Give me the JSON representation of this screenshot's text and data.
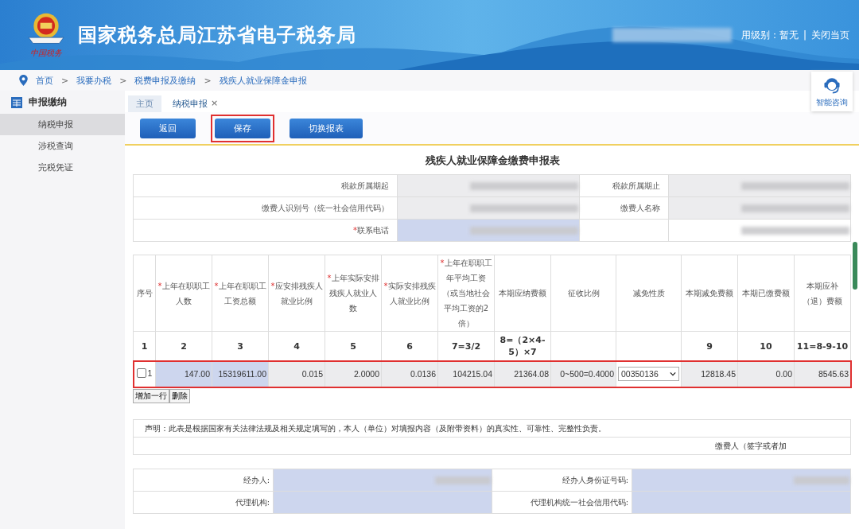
{
  "header": {
    "logo_caption": "中国税务",
    "title": "国家税务总局江苏省电子税务局",
    "user_level": "用级别：暂无",
    "divider": "|",
    "close_link": "关闭当页"
  },
  "breadcrumb": {
    "separator": ">",
    "items": [
      "首页",
      "我要办税",
      "税费申报及缴纳",
      "残疾人就业保障金申报"
    ]
  },
  "help": {
    "label": "智能咨询"
  },
  "sidebar": {
    "title": "申报缴纳",
    "items": [
      {
        "label": "纳税申报",
        "selected": true
      },
      {
        "label": "涉税查询",
        "selected": false
      },
      {
        "label": "完税凭证",
        "selected": false
      }
    ]
  },
  "tabs": [
    {
      "label": "主页",
      "selected": false
    },
    {
      "label": "纳税申报",
      "selected": true,
      "close": "×"
    }
  ],
  "toolbar": [
    {
      "label": "返回",
      "highlighted": false
    },
    {
      "label": "保存",
      "highlighted": true
    },
    {
      "label": "切换报表",
      "highlighted": false
    }
  ],
  "form_title": "残疾人就业保障金缴费申报表",
  "required_mark": "*",
  "info_rows": [
    {
      "fields": [
        {
          "label": "税款所属期起",
          "required": false,
          "kind": "readonly"
        },
        {
          "label": "税款所属期止",
          "required": false,
          "kind": "readonly"
        }
      ]
    },
    {
      "fields": [
        {
          "label": "缴费人识别号（统一社会信用代码）",
          "required": false,
          "kind": "readonly"
        },
        {
          "label": "缴费人名称",
          "required": false,
          "kind": "readonly"
        }
      ]
    },
    {
      "fields": [
        {
          "label": "联系电话",
          "required": true,
          "kind": "input"
        },
        {
          "kind": "plain"
        }
      ]
    }
  ],
  "columns": [
    {
      "label": "序号",
      "required": false,
      "number": "1"
    },
    {
      "label": "上年在职职工人数",
      "required": true,
      "number": "2"
    },
    {
      "label": "上年在职职工工资总额",
      "required": true,
      "number": "3"
    },
    {
      "label": "应安排残疾人就业比例",
      "required": true,
      "number": "4"
    },
    {
      "label": "上年实际安排残疾人就业人数",
      "required": true,
      "number": "5"
    },
    {
      "label": "实际安排残疾人就业比例",
      "required": true,
      "number": "6"
    },
    {
      "label": "上年在职职工年平均工资（或当地社会平均工资的2倍）",
      "required": true,
      "number": "7=3/2"
    },
    {
      "label": "本期应纳费额",
      "required": false,
      "number": "8=（2×4-5）×7"
    },
    {
      "label": "征收比例",
      "required": false
    },
    {
      "label": "减免性质",
      "required": false
    },
    {
      "label": "本期减免费额",
      "required": false,
      "number": "9"
    },
    {
      "label": "本期已缴费额",
      "required": false,
      "number": "10"
    },
    {
      "label": "本期应补（退）费额",
      "required": false,
      "number": "11=8-9-10"
    }
  ],
  "rows": [
    {
      "checked": false,
      "seq": "1",
      "highlighted": true,
      "cells": [
        {
          "value": "147.00",
          "kind": "input"
        },
        {
          "value": "15319611.00",
          "kind": "input"
        },
        {
          "value": "0.015",
          "kind": "readonly"
        },
        {
          "value": "2.0000",
          "kind": "readonly"
        },
        {
          "value": "0.0136",
          "kind": "readonly"
        },
        {
          "value": "104215.04",
          "kind": "readonly"
        },
        {
          "value": "21364.08",
          "kind": "readonly"
        },
        {
          "value": "0~500=0.4000",
          "kind": "readonly"
        },
        {
          "value": "00350136",
          "kind": "select"
        },
        {
          "value": "12818.45",
          "kind": "readonly"
        },
        {
          "value": "0.00",
          "kind": "readonly"
        },
        {
          "value": "8545.63",
          "kind": "readonly"
        }
      ]
    }
  ],
  "row_buttons": [
    "增加一行",
    "删除"
  ],
  "statement": {
    "text": "声明：此表是根据国家有关法律法规及相关规定填写的，本人（单位）对填报内容（及附带资料）的真实性、可靠性、完整性负责。",
    "signature": "缴费人（签字或者加"
  },
  "agent_rows": [
    {
      "fields": [
        {
          "label": "经办人:",
          "redacted": true
        },
        {
          "label": "经办人身份证号码:",
          "redacted": true
        }
      ]
    },
    {
      "fields": [
        {
          "label": "代理机构:",
          "redacted": false
        },
        {
          "label": "代理机构统一社会信用代码:",
          "redacted": false
        }
      ]
    }
  ]
}
